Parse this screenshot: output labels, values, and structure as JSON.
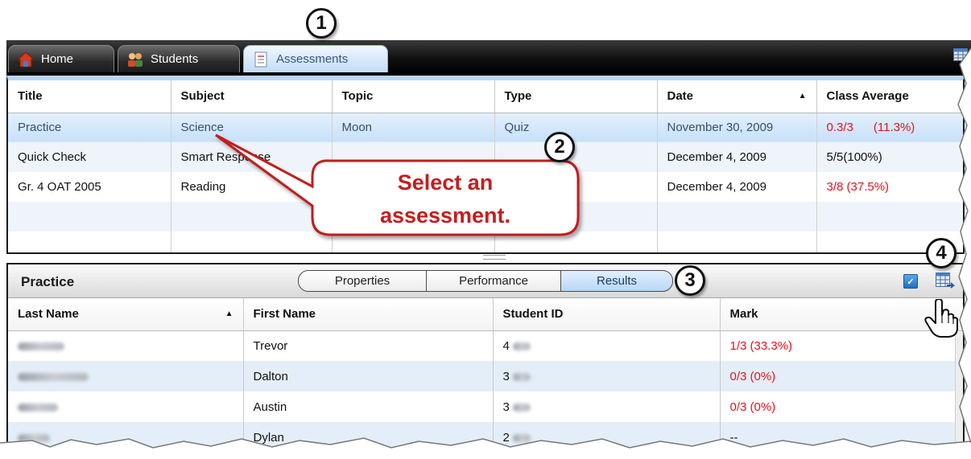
{
  "tabs": [
    {
      "label": "Home",
      "icon": "home-icon"
    },
    {
      "label": "Students",
      "icon": "students-icon"
    },
    {
      "label": "Assessments",
      "icon": "assessments-icon",
      "active": true
    }
  ],
  "assessments_table": {
    "headers": {
      "title": "Title",
      "subject": "Subject",
      "topic": "Topic",
      "type": "Type",
      "date": "Date",
      "class_average": "Class Average"
    },
    "sort_arrow": "▲",
    "rows": [
      {
        "title": "Practice",
        "subject": "Science",
        "topic": "Moon",
        "type": "Quiz",
        "date": "November 30, 2009",
        "avg_score": "0.3/3",
        "avg_pct": "(11.3%)"
      },
      {
        "title": "Quick Check",
        "subject": "Smart Response",
        "topic": "",
        "type": "",
        "date": "December 4, 2009",
        "avg_score": "5/5",
        "avg_pct": "(100%)"
      },
      {
        "title": "Gr. 4 OAT 2005",
        "subject": "Reading",
        "topic": "",
        "type": "",
        "date": "December 4, 2009",
        "avg_score": "3/8",
        "avg_pct": "(37.5%)"
      }
    ]
  },
  "detail": {
    "title": "Practice",
    "view_buttons": {
      "properties": "Properties",
      "performance": "Performance",
      "results": "Results"
    },
    "headers": {
      "last_name": "Last Name",
      "first_name": "First Name",
      "student_id": "Student ID",
      "mark": "Mark"
    },
    "sort_arrow": "▲",
    "edit_icon_glyph": "✓",
    "rows": [
      {
        "first_name": "Trevor",
        "student_id_prefix": "4",
        "mark": "1/3 (33.3%)"
      },
      {
        "first_name": "Dalton",
        "student_id_prefix": "3",
        "mark": "0/3 (0%)"
      },
      {
        "first_name": "Austin",
        "student_id_prefix": "3",
        "mark": "0/3 (0%)"
      },
      {
        "first_name": "Dylan",
        "student_id_prefix": "2",
        "mark": "--"
      }
    ]
  },
  "annotations": {
    "step1": "1",
    "step2": "2",
    "step3": "3",
    "step4": "4",
    "callout_line1": "Select an",
    "callout_line2": "assessment."
  },
  "colors": {
    "accent_red": "#e0141e",
    "callout_red": "#c41e1e",
    "selection_blue": "#c6e0f9"
  }
}
